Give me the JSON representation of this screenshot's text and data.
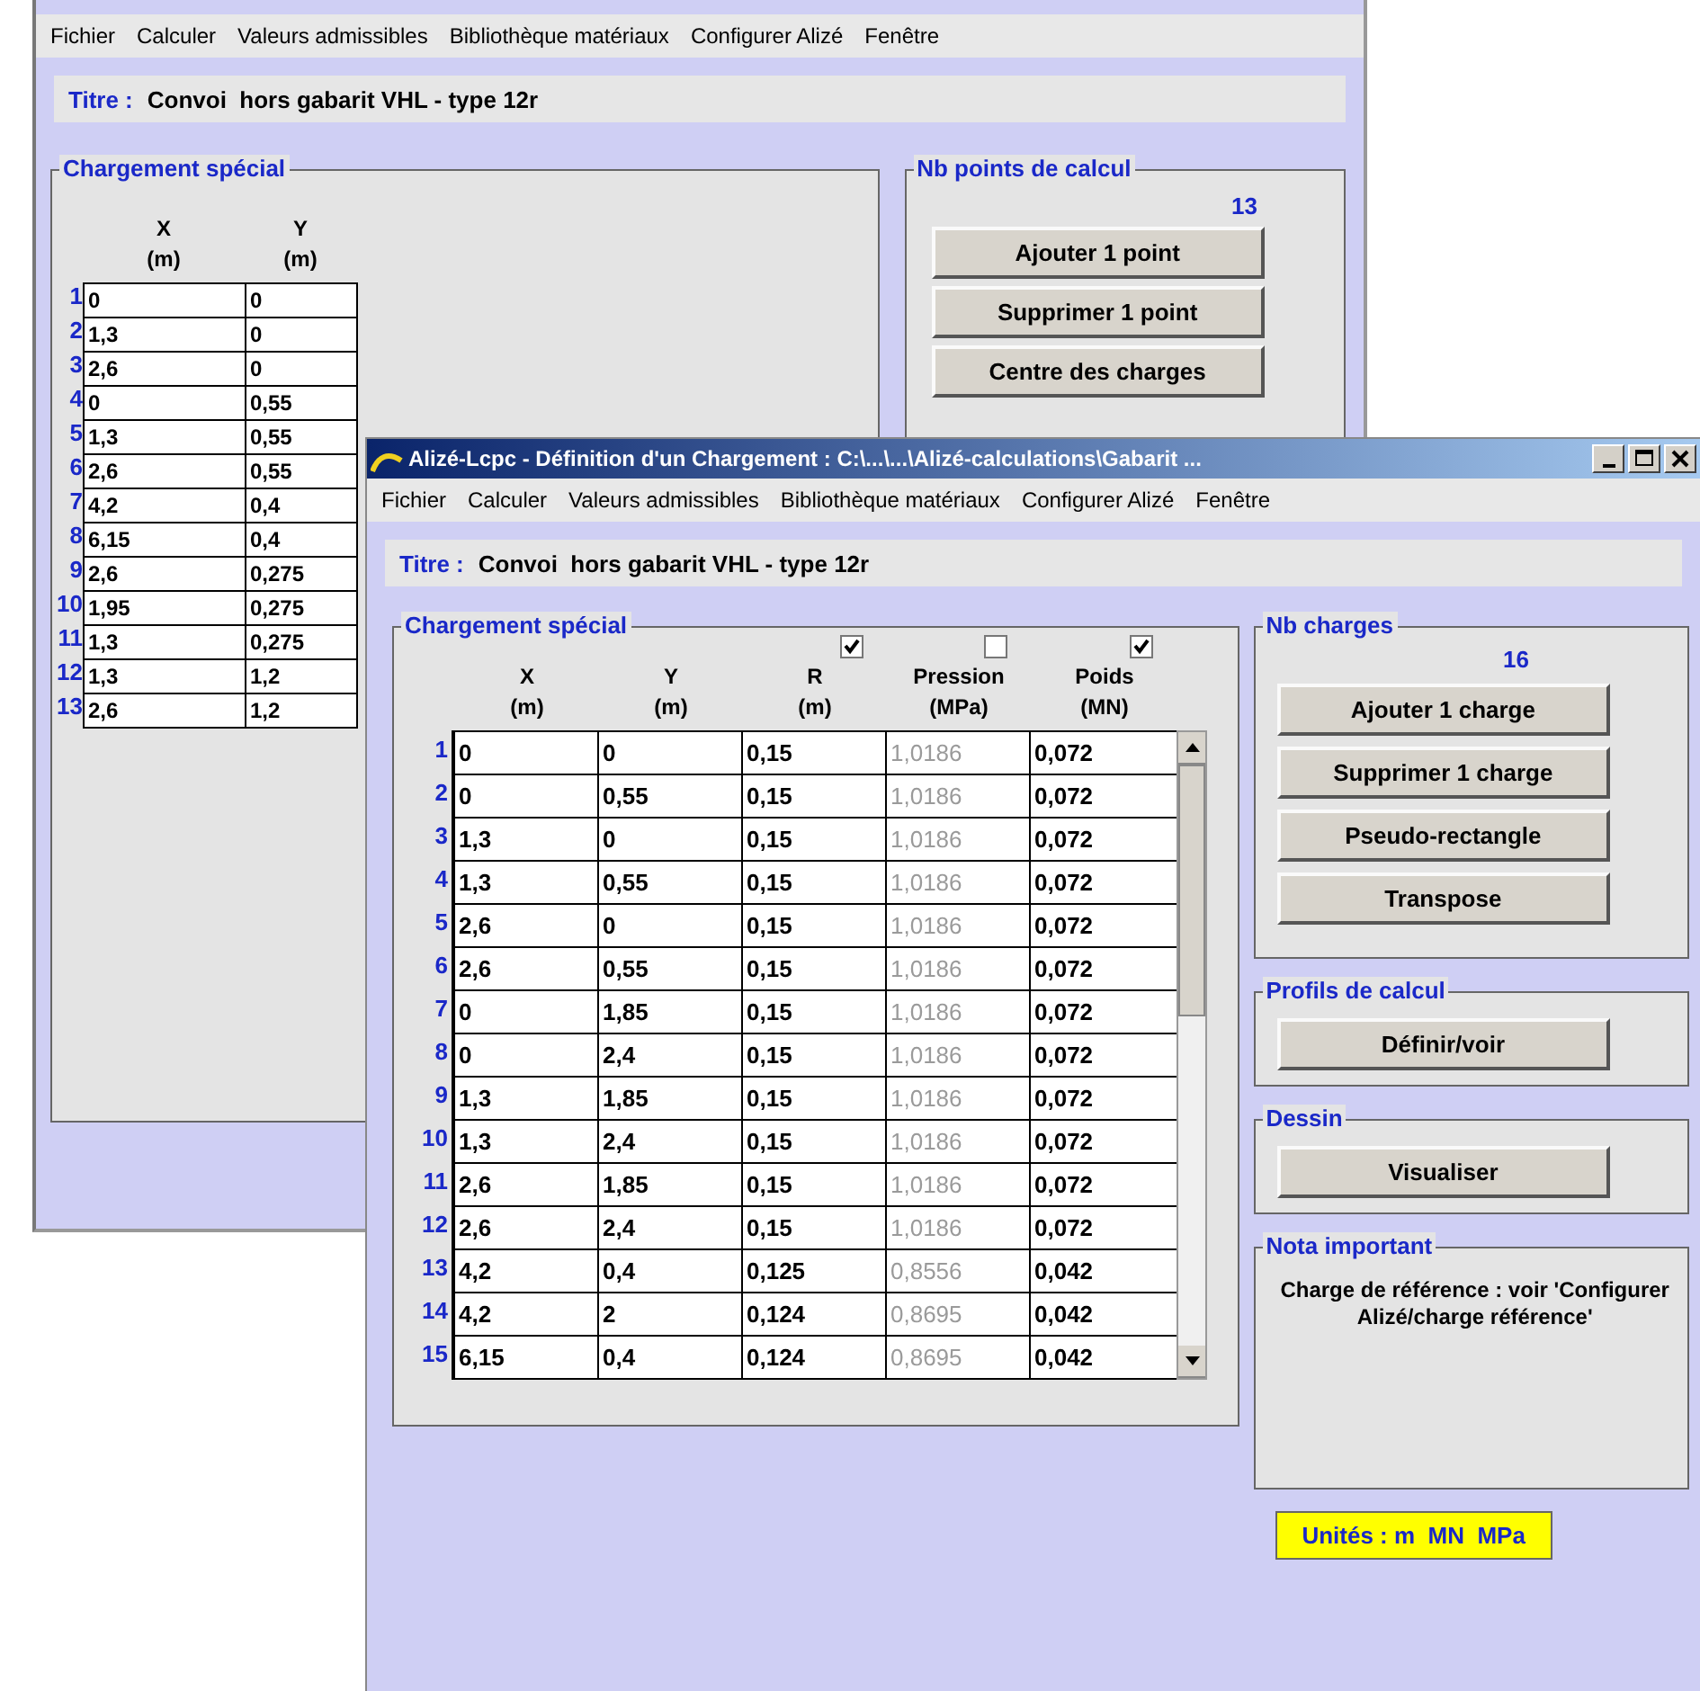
{
  "back_window": {
    "menu": [
      "Fichier",
      "Calculer",
      "Valeurs admissibles",
      "Bibliothèque matériaux",
      "Configurer Alizé",
      "Fenêtre"
    ],
    "title_label": "Titre :",
    "title_value": "Convoi  hors gabarit VHL - type 12r",
    "load_group": {
      "legend": "Chargement spécial",
      "columns": [
        {
          "label": "X",
          "unit": "(m)"
        },
        {
          "label": "Y",
          "unit": "(m)"
        }
      ],
      "rows": [
        {
          "index": "1",
          "cells": [
            "0",
            "0"
          ]
        },
        {
          "index": "2",
          "cells": [
            "1,3",
            "0"
          ]
        },
        {
          "index": "3",
          "cells": [
            "2,6",
            "0"
          ]
        },
        {
          "index": "4",
          "cells": [
            "0",
            "0,55"
          ]
        },
        {
          "index": "5",
          "cells": [
            "1,3",
            "0,55"
          ]
        },
        {
          "index": "6",
          "cells": [
            "2,6",
            "0,55"
          ]
        },
        {
          "index": "7",
          "cells": [
            "4,2",
            "0,4"
          ]
        },
        {
          "index": "8",
          "cells": [
            "6,15",
            "0,4"
          ]
        },
        {
          "index": "9",
          "cells": [
            "2,6",
            "0,275"
          ]
        },
        {
          "index": "10",
          "cells": [
            "1,95",
            "0,275"
          ]
        },
        {
          "index": "11",
          "cells": [
            "1,3",
            "0,275"
          ]
        },
        {
          "index": "12",
          "cells": [
            "1,3",
            "1,2"
          ]
        },
        {
          "index": "13",
          "cells": [
            "2,6",
            "1,2"
          ]
        }
      ]
    },
    "points_group": {
      "legend": "Nb points de calcul",
      "count": "13",
      "buttons": [
        "Ajouter 1 point",
        "Supprimer 1 point",
        "Centre des charges"
      ]
    }
  },
  "front_window": {
    "title": "Alizé-Lcpc - Définition d'un Chargement : C:\\...\\...\\Alizé-calculations\\Gabarit ...",
    "menu": [
      "Fichier",
      "Calculer",
      "Valeurs admissibles",
      "Bibliothèque matériaux",
      "Configurer Alizé",
      "Fenêtre"
    ],
    "title_label": "Titre :",
    "title_value": "Convoi  hors gabarit VHL - type 12r",
    "load_group": {
      "legend": "Chargement spécial",
      "columns": [
        {
          "kind": "plain",
          "label": "X",
          "unit": "(m)"
        },
        {
          "kind": "plain",
          "label": "Y",
          "unit": "(m)"
        },
        {
          "kind": "toggle",
          "checked": true,
          "label": "R",
          "unit": "(m)"
        },
        {
          "kind": "toggle",
          "checked": false,
          "label": "Pression",
          "unit": "(MPa)"
        },
        {
          "kind": "toggle",
          "checked": true,
          "label": "Poids",
          "unit": "(MN)"
        }
      ],
      "rows": [
        {
          "index": "1",
          "cells": [
            "0",
            "0",
            "0,15",
            "1,0186",
            "0,072"
          ]
        },
        {
          "index": "2",
          "cells": [
            "0",
            "0,55",
            "0,15",
            "1,0186",
            "0,072"
          ]
        },
        {
          "index": "3",
          "cells": [
            "1,3",
            "0",
            "0,15",
            "1,0186",
            "0,072"
          ]
        },
        {
          "index": "4",
          "cells": [
            "1,3",
            "0,55",
            "0,15",
            "1,0186",
            "0,072"
          ]
        },
        {
          "index": "5",
          "cells": [
            "2,6",
            "0",
            "0,15",
            "1,0186",
            "0,072"
          ]
        },
        {
          "index": "6",
          "cells": [
            "2,6",
            "0,55",
            "0,15",
            "1,0186",
            "0,072"
          ]
        },
        {
          "index": "7",
          "cells": [
            "0",
            "1,85",
            "0,15",
            "1,0186",
            "0,072"
          ]
        },
        {
          "index": "8",
          "cells": [
            "0",
            "2,4",
            "0,15",
            "1,0186",
            "0,072"
          ]
        },
        {
          "index": "9",
          "cells": [
            "1,3",
            "1,85",
            "0,15",
            "1,0186",
            "0,072"
          ]
        },
        {
          "index": "10",
          "cells": [
            "1,3",
            "2,4",
            "0,15",
            "1,0186",
            "0,072"
          ]
        },
        {
          "index": "11",
          "cells": [
            "2,6",
            "1,85",
            "0,15",
            "1,0186",
            "0,072"
          ]
        },
        {
          "index": "12",
          "cells": [
            "2,6",
            "2,4",
            "0,15",
            "1,0186",
            "0,072"
          ]
        },
        {
          "index": "13",
          "cells": [
            "4,2",
            "0,4",
            "0,125",
            "0,8556",
            "0,042"
          ]
        },
        {
          "index": "14",
          "cells": [
            "4,2",
            "2",
            "0,124",
            "0,8695",
            "0,042"
          ]
        },
        {
          "index": "15",
          "cells": [
            "6,15",
            "0,4",
            "0,124",
            "0,8695",
            "0,042"
          ]
        }
      ]
    },
    "charges_group": {
      "legend": "Nb charges",
      "count": "16",
      "buttons": [
        "Ajouter 1 charge",
        "Supprimer 1 charge",
        "Pseudo-rectangle",
        "Transpose"
      ]
    },
    "profiles_group": {
      "legend": "Profils de calcul",
      "buttons": [
        "Définir/voir"
      ]
    },
    "drawing_group": {
      "legend": "Dessin",
      "buttons": [
        "Visualiser"
      ]
    },
    "note_group": {
      "legend": "Nota important",
      "text": "Charge de référence : voir 'Configurer Alizé/charge référence'"
    },
    "units": "Unités : m  MN  MPa"
  }
}
